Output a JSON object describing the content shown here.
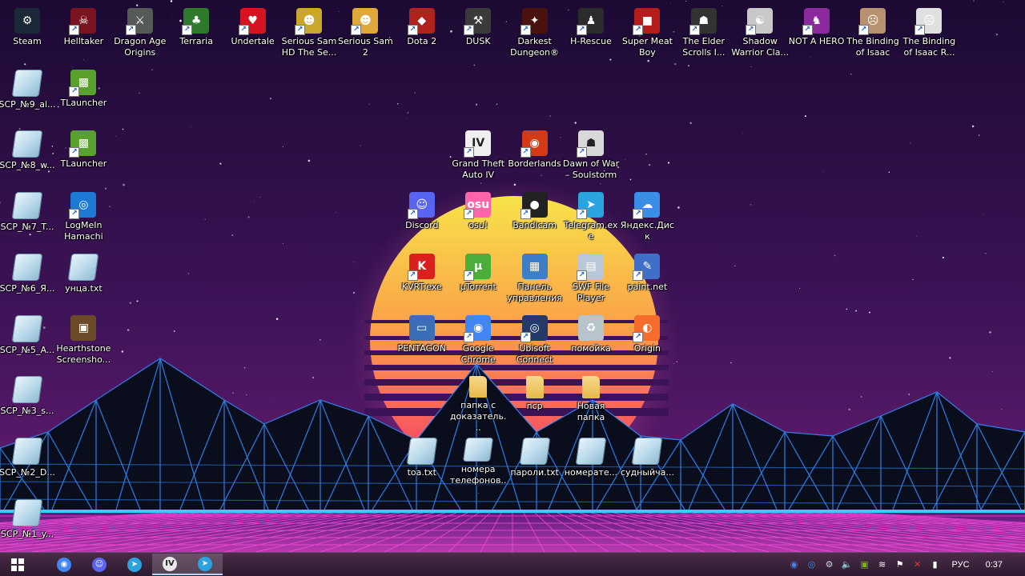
{
  "colors": {
    "sky_top": "#1b0a33",
    "sky_mid": "#4a1a5e",
    "sun_top": "#f7e34a",
    "sun_bottom": "#f5336c",
    "grid": "#d033d6",
    "mountain_line": "#2f8cff",
    "taskbar": "#3a2340"
  },
  "icons": [
    {
      "label": "Steam",
      "col": 0,
      "row": 0,
      "bg": "#1b2838",
      "glyph": "⚙",
      "shortcut": false
    },
    {
      "label": "Helltaker",
      "col": 1,
      "row": 0,
      "bg": "#7a1420",
      "glyph": "☠",
      "shortcut": true
    },
    {
      "label": "Dragon Age Origins",
      "col": 2,
      "row": 0,
      "bg": "#555a57",
      "glyph": "⚔",
      "shortcut": true
    },
    {
      "label": "Terraria",
      "col": 3,
      "row": 0,
      "bg": "#2f7a2a",
      "glyph": "♣",
      "shortcut": true
    },
    {
      "label": "Undertale",
      "col": 4,
      "row": 0,
      "bg": "#d4141e",
      "glyph": "♥",
      "shortcut": true
    },
    {
      "label": "Serious Sam HD The Se...",
      "col": 5,
      "row": 0,
      "bg": "#caa62a",
      "glyph": "☻",
      "shortcut": true
    },
    {
      "label": "Serious Sam 2",
      "col": 6,
      "row": 0,
      "bg": "#e0a83a",
      "glyph": "☻",
      "shortcut": true
    },
    {
      "label": "Dota 2",
      "col": 7,
      "row": 0,
      "bg": "#b0231c",
      "glyph": "◆",
      "shortcut": true
    },
    {
      "label": "DUSK",
      "col": 8,
      "row": 0,
      "bg": "#3a3a3a",
      "glyph": "⚒",
      "shortcut": true
    },
    {
      "label": "Darkest Dungeon®",
      "col": 9,
      "row": 0,
      "bg": "#4a120c",
      "glyph": "✦",
      "shortcut": true
    },
    {
      "label": "H-Rescue",
      "col": 10,
      "row": 0,
      "bg": "#2c2c2c",
      "glyph": "♟",
      "shortcut": true
    },
    {
      "label": "Super Meat Boy",
      "col": 11,
      "row": 0,
      "bg": "#b51d1d",
      "glyph": "■",
      "shortcut": true
    },
    {
      "label": "The Elder Scrolls I...",
      "col": 12,
      "row": 0,
      "bg": "#333333",
      "glyph": "☗",
      "shortcut": true
    },
    {
      "label": "Shadow Warrior Cla...",
      "col": 13,
      "row": 0,
      "bg": "#c8c8c8",
      "glyph": "☯",
      "shortcut": true
    },
    {
      "label": "NOT A HERO",
      "col": 14,
      "row": 0,
      "bg": "#8a2a9c",
      "glyph": "♞",
      "shortcut": true
    },
    {
      "label": "The Binding of Isaac",
      "col": 15,
      "row": 0,
      "bg": "#b8926e",
      "glyph": "☹",
      "shortcut": true
    },
    {
      "label": "The Binding of Isaac R...",
      "col": 16,
      "row": 0,
      "bg": "#e0e0e0",
      "glyph": "☹",
      "shortcut": true
    },
    {
      "label": "SCP_№9_al...",
      "col": 0,
      "row": 1,
      "type": "file"
    },
    {
      "label": "TLauncher",
      "col": 1,
      "row": 1,
      "bg": "#5aa02c",
      "glyph": "▩",
      "shortcut": true
    },
    {
      "label": "SCP_№8_w...",
      "col": 0,
      "row": 2,
      "type": "file"
    },
    {
      "label": "TLauncher",
      "col": 1,
      "row": 2,
      "bg": "#5aa02c",
      "glyph": "▩",
      "shortcut": true
    },
    {
      "label": "Grand Theft Auto IV",
      "col": 8,
      "row": 2,
      "bg": "#f0f0f0",
      "glyph": "IV",
      "shortcut": true,
      "dark": true
    },
    {
      "label": "Borderlands",
      "col": 9,
      "row": 2,
      "bg": "#d43a14",
      "glyph": "◉",
      "shortcut": true
    },
    {
      "label": "Dawn of War – Soulstorm",
      "col": 10,
      "row": 2,
      "bg": "#d8d8d8",
      "glyph": "☗",
      "shortcut": true,
      "dark": true
    },
    {
      "label": "SCP_№7_T...",
      "col": 0,
      "row": 3,
      "type": "file"
    },
    {
      "label": "LogMeIn Hamachi",
      "col": 1,
      "row": 3,
      "bg": "#1c7ad4",
      "glyph": "◎",
      "shortcut": true
    },
    {
      "label": "Discord",
      "col": 7,
      "row": 3,
      "bg": "#5865f2",
      "glyph": "☺",
      "shortcut": true
    },
    {
      "label": "osu!",
      "col": 8,
      "row": 3,
      "bg": "#ff66aa",
      "glyph": "osu",
      "shortcut": true
    },
    {
      "label": "Bandicam",
      "col": 9,
      "row": 3,
      "bg": "#222222",
      "glyph": "●",
      "shortcut": true
    },
    {
      "label": "Telegram.exe",
      "col": 10,
      "row": 3,
      "bg": "#2aa3df",
      "glyph": "➤",
      "shortcut": true
    },
    {
      "label": "Яндекс.Диск",
      "col": 11,
      "row": 3,
      "bg": "#3a8ee6",
      "glyph": "☁",
      "shortcut": true
    },
    {
      "label": "SCP_№6_Я...",
      "col": 0,
      "row": 4,
      "type": "file"
    },
    {
      "label": "унца.txt",
      "col": 1,
      "row": 4,
      "type": "file"
    },
    {
      "label": "KVRT.exe",
      "col": 7,
      "row": 4,
      "bg": "#d9201c",
      "glyph": "K",
      "shortcut": true
    },
    {
      "label": "µTorrent",
      "col": 8,
      "row": 4,
      "bg": "#4cae3a",
      "glyph": "µ",
      "shortcut": true
    },
    {
      "label": "Панель управления",
      "col": 9,
      "row": 4,
      "bg": "#3c7fc8",
      "glyph": "▦",
      "shortcut": false
    },
    {
      "label": "SWF File Player",
      "col": 10,
      "row": 4,
      "bg": "#b8c8d8",
      "glyph": "▤",
      "shortcut": true
    },
    {
      "label": "paint.net",
      "col": 11,
      "row": 4,
      "bg": "#3f6fc8",
      "glyph": "✎",
      "shortcut": true
    },
    {
      "label": "SCP_№5_A...",
      "col": 0,
      "row": 5,
      "type": "file"
    },
    {
      "label": "Hearthstone Screensho...",
      "col": 1,
      "row": 5,
      "bg": "#6b4a2a",
      "glyph": "▣",
      "shortcut": false
    },
    {
      "label": "PENTAGON",
      "col": 7,
      "row": 5,
      "bg": "#3a6fb8",
      "glyph": "▭",
      "shortcut": false
    },
    {
      "label": "Google Chrome",
      "col": 8,
      "row": 5,
      "bg": "#4285f4",
      "glyph": "◉",
      "shortcut": true
    },
    {
      "label": "Ubisoft Connect",
      "col": 9,
      "row": 5,
      "bg": "#243a6a",
      "glyph": "◎",
      "shortcut": true
    },
    {
      "label": "помойка",
      "col": 10,
      "row": 5,
      "bg": "#b8c4cc",
      "glyph": "♻",
      "shortcut": false
    },
    {
      "label": "Origin",
      "col": 11,
      "row": 5,
      "bg": "#f56c2d",
      "glyph": "◐",
      "shortcut": true
    },
    {
      "label": "SCP_№3_s...",
      "col": 0,
      "row": 6,
      "type": "file"
    },
    {
      "label": "папка с доказатель...",
      "col": 8,
      "row": 6,
      "type": "folder"
    },
    {
      "label": "ncp",
      "col": 9,
      "row": 6,
      "type": "folder"
    },
    {
      "label": "Новая папка",
      "col": 10,
      "row": 6,
      "type": "folder"
    },
    {
      "label": "SCP_№2_D...",
      "col": 0,
      "row": 7,
      "type": "file"
    },
    {
      "label": "toa.txt",
      "col": 7,
      "row": 7,
      "type": "file"
    },
    {
      "label": "номера телефонов...",
      "col": 8,
      "row": 7,
      "type": "file"
    },
    {
      "label": "пароли.txt",
      "col": 9,
      "row": 7,
      "type": "file"
    },
    {
      "label": "номерате...",
      "col": 10,
      "row": 7,
      "type": "file"
    },
    {
      "label": "судныйча...",
      "col": 11,
      "row": 7,
      "type": "file"
    },
    {
      "label": "SCP_№1_y...",
      "col": 0,
      "row": 8,
      "type": "file"
    }
  ],
  "taskbar": {
    "start_icon": "windows-logo-icon",
    "pinned": [
      {
        "name": "chrome",
        "glyph": "◉",
        "color": "#4285f4"
      },
      {
        "name": "discord",
        "glyph": "☺",
        "color": "#5865f2"
      },
      {
        "name": "telegram",
        "glyph": "➤",
        "color": "#2aa3df"
      },
      {
        "name": "gta-iv",
        "glyph": "IV",
        "color": "#e8e8e8",
        "active": true
      },
      {
        "name": "telegram-window",
        "glyph": "➤",
        "color": "#2aa3df",
        "active": true
      }
    ],
    "tray_icons": [
      "chrome-tray-icon",
      "network-tray-icon",
      "steam-tray-icon",
      "volume-icon",
      "nvidia-icon",
      "wifi-icon",
      "flag-icon",
      "security-icon",
      "signal-icon"
    ],
    "language": "РУС",
    "clock": "0:37"
  }
}
